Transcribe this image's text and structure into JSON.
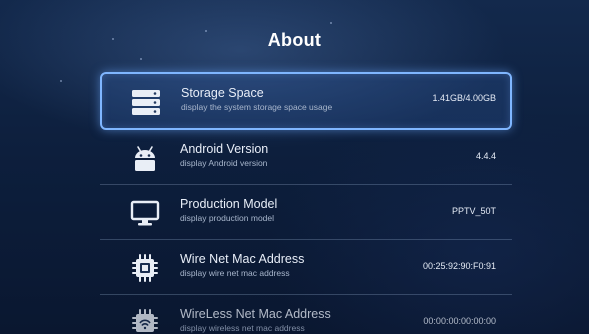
{
  "page": {
    "title": "About"
  },
  "items": [
    {
      "label": "Storage Space",
      "sub": "display the system storage space usage",
      "value": "1.41GB/4.00GB",
      "icon": "storage-icon",
      "selected": true
    },
    {
      "label": "Android Version",
      "sub": "display Android version",
      "value": "4.4.4",
      "icon": "android-icon",
      "selected": false
    },
    {
      "label": "Production Model",
      "sub": "display production model",
      "value": "PPTV_50T",
      "icon": "monitor-icon",
      "selected": false
    },
    {
      "label": "Wire Net Mac Address",
      "sub": "display wire net mac address",
      "value": "00:25:92:90:F0:91",
      "icon": "ethernet-chip-icon",
      "selected": false
    },
    {
      "label": "WireLess Net Mac Address",
      "sub": "display wireless net mac address",
      "value": "00:00:00:00:00:00",
      "icon": "wifi-chip-icon",
      "selected": false
    }
  ],
  "colors": {
    "accent": "#7fb6ff",
    "background": "#0d1f3d"
  }
}
